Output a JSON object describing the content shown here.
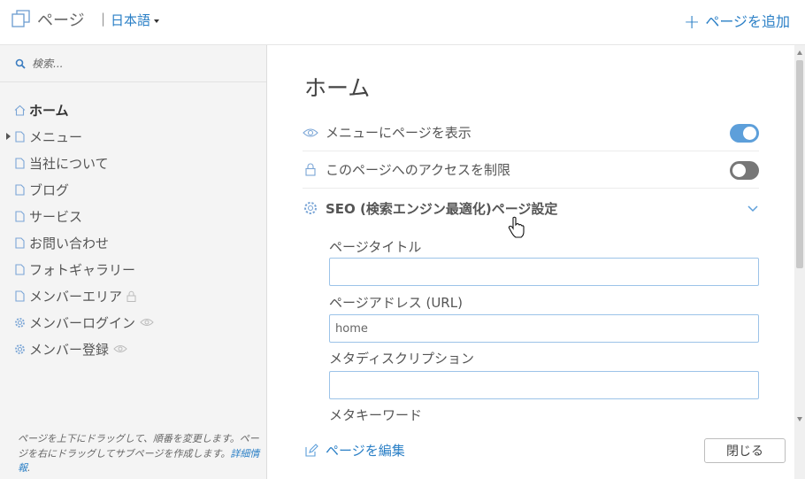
{
  "header": {
    "title": "ページ",
    "separator": "|",
    "language": "日本語",
    "add_page_label": "ページを追加",
    "add_icon": "plus-icon"
  },
  "sidebar": {
    "search_placeholder": "検索...",
    "items": [
      {
        "label": "ホーム",
        "icon": "home-icon",
        "active": true
      },
      {
        "label": "メニュー",
        "icon": "page-icon",
        "expandable": true
      },
      {
        "label": "当社について",
        "icon": "page-icon"
      },
      {
        "label": "ブログ",
        "icon": "page-icon"
      },
      {
        "label": "サービス",
        "icon": "page-icon"
      },
      {
        "label": "お問い合わせ",
        "icon": "page-icon"
      },
      {
        "label": "フォトギャラリー",
        "icon": "page-icon"
      },
      {
        "label": "メンバーエリア",
        "icon": "page-icon",
        "extra": "lock-icon"
      },
      {
        "label": "メンバーログイン",
        "icon": "gear-icon",
        "extra": "eye-icon"
      },
      {
        "label": "メンバー登録",
        "icon": "gear-icon",
        "extra": "eye-icon"
      }
    ],
    "help_text": "ページを上下にドラッグして、順番を変更します。ページを右にドラッグしてサブページを作成します。",
    "help_link": "詳細情報"
  },
  "main": {
    "page_title": "ホーム",
    "show_in_menu_label": "メニューにページを表示",
    "show_in_menu_on": true,
    "restrict_access_label": "このページへのアクセスを制限",
    "restrict_access_on": false,
    "seo_label": "SEO (検索エンジン最適化)ページ設定",
    "fields": {
      "page_title_label": "ページタイトル",
      "page_title_value": "",
      "page_address_label": "ページアドレス (URL)",
      "page_address_value": "home",
      "meta_description_label": "メタディスクリプション",
      "meta_description_value": "",
      "meta_keywords_label": "メタキーワード"
    },
    "edit_page_label": "ページを編集",
    "close_label": "閉じる"
  },
  "colors": {
    "accent": "#2a7fc6",
    "toggle_on": "#5d9fda",
    "toggle_off": "#777777"
  }
}
